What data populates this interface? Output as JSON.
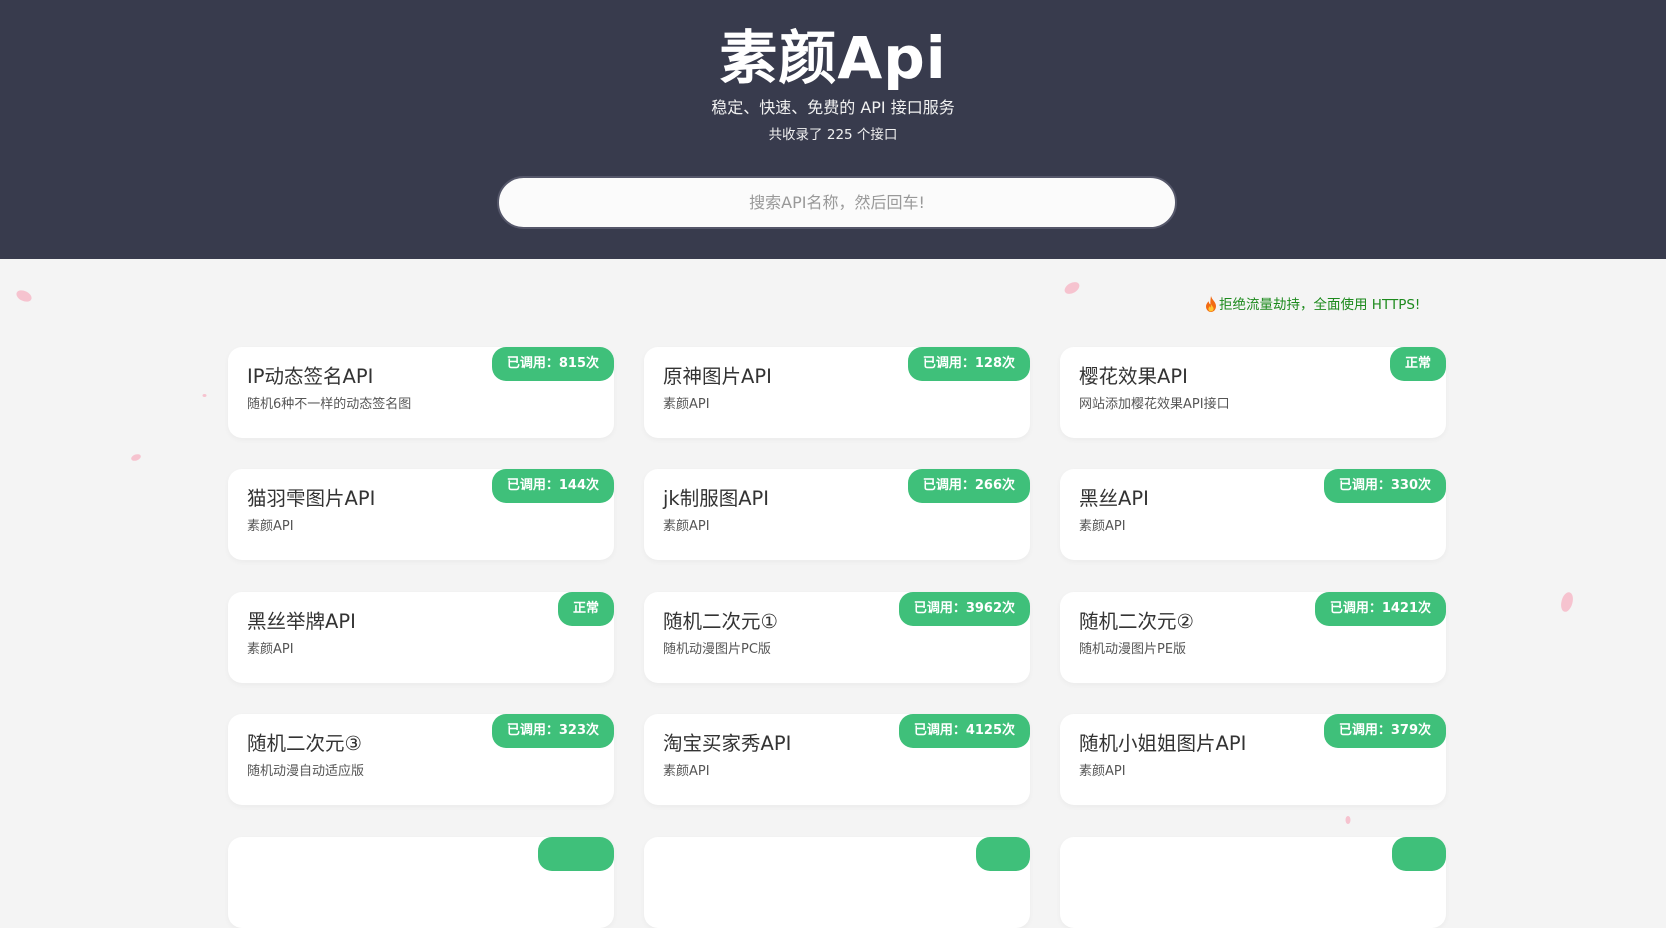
{
  "header": {
    "title": "素颜Api",
    "subtitle": "稳定、快速、免费的 API 接口服务",
    "count_text": "共收录了 225 个接口"
  },
  "search": {
    "placeholder": "搜索API名称，然后回车!"
  },
  "notice": {
    "icon": "fire-icon",
    "text": "拒绝流量劫持，全面使用 HTTPS!"
  },
  "cards": [
    {
      "title": "IP动态签名API",
      "desc": "随机6种不一样的动态签名图",
      "badge": "已调用：815次"
    },
    {
      "title": "原神图片API",
      "desc": "素颜API",
      "badge": "已调用：128次"
    },
    {
      "title": "樱花效果API",
      "desc": "网站添加樱花效果API接口",
      "badge": "正常"
    },
    {
      "title": "猫羽雫图片API",
      "desc": "素颜API",
      "badge": "已调用：144次"
    },
    {
      "title": "jk制服图API",
      "desc": "素颜API",
      "badge": "已调用：266次"
    },
    {
      "title": "黑丝API",
      "desc": "素颜API",
      "badge": "已调用：330次"
    },
    {
      "title": "黑丝举牌API",
      "desc": "素颜API",
      "badge": "正常"
    },
    {
      "title": "随机二次元①",
      "desc": "随机动漫图片PC版",
      "badge": "已调用：3962次"
    },
    {
      "title": "随机二次元②",
      "desc": "随机动漫图片PE版",
      "badge": "已调用：1421次"
    },
    {
      "title": "随机二次元③",
      "desc": "随机动漫自动适应版",
      "badge": "已调用：323次"
    },
    {
      "title": "淘宝买家秀API",
      "desc": "素颜API",
      "badge": "已调用：4125次"
    },
    {
      "title": "随机小姐姐图片API",
      "desc": "素颜API",
      "badge": "已调用：379次"
    }
  ],
  "colors": {
    "header_bg": "#383b4d",
    "page_bg": "#f4f4f4",
    "badge": "#3fc07a",
    "notice": "#1d8a1d"
  }
}
